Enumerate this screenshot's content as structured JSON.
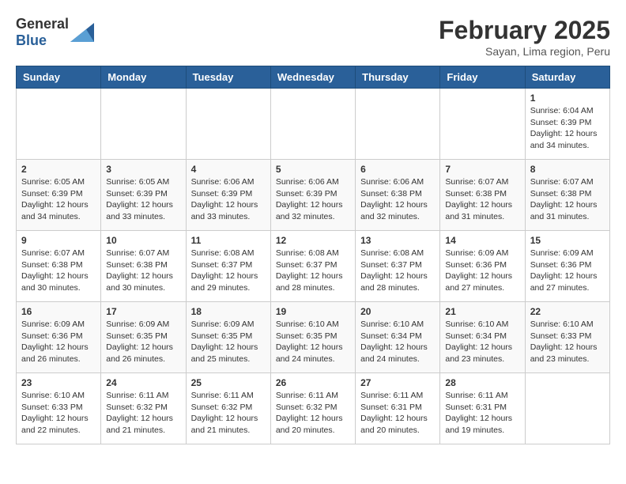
{
  "header": {
    "logo_general": "General",
    "logo_blue": "Blue",
    "month_title": "February 2025",
    "subtitle": "Sayan, Lima region, Peru"
  },
  "weekdays": [
    "Sunday",
    "Monday",
    "Tuesday",
    "Wednesday",
    "Thursday",
    "Friday",
    "Saturday"
  ],
  "weeks": [
    [
      {
        "day": "",
        "info": ""
      },
      {
        "day": "",
        "info": ""
      },
      {
        "day": "",
        "info": ""
      },
      {
        "day": "",
        "info": ""
      },
      {
        "day": "",
        "info": ""
      },
      {
        "day": "",
        "info": ""
      },
      {
        "day": "1",
        "info": "Sunrise: 6:04 AM\nSunset: 6:39 PM\nDaylight: 12 hours\nand 34 minutes."
      }
    ],
    [
      {
        "day": "2",
        "info": "Sunrise: 6:05 AM\nSunset: 6:39 PM\nDaylight: 12 hours\nand 34 minutes."
      },
      {
        "day": "3",
        "info": "Sunrise: 6:05 AM\nSunset: 6:39 PM\nDaylight: 12 hours\nand 33 minutes."
      },
      {
        "day": "4",
        "info": "Sunrise: 6:06 AM\nSunset: 6:39 PM\nDaylight: 12 hours\nand 33 minutes."
      },
      {
        "day": "5",
        "info": "Sunrise: 6:06 AM\nSunset: 6:39 PM\nDaylight: 12 hours\nand 32 minutes."
      },
      {
        "day": "6",
        "info": "Sunrise: 6:06 AM\nSunset: 6:38 PM\nDaylight: 12 hours\nand 32 minutes."
      },
      {
        "day": "7",
        "info": "Sunrise: 6:07 AM\nSunset: 6:38 PM\nDaylight: 12 hours\nand 31 minutes."
      },
      {
        "day": "8",
        "info": "Sunrise: 6:07 AM\nSunset: 6:38 PM\nDaylight: 12 hours\nand 31 minutes."
      }
    ],
    [
      {
        "day": "9",
        "info": "Sunrise: 6:07 AM\nSunset: 6:38 PM\nDaylight: 12 hours\nand 30 minutes."
      },
      {
        "day": "10",
        "info": "Sunrise: 6:07 AM\nSunset: 6:38 PM\nDaylight: 12 hours\nand 30 minutes."
      },
      {
        "day": "11",
        "info": "Sunrise: 6:08 AM\nSunset: 6:37 PM\nDaylight: 12 hours\nand 29 minutes."
      },
      {
        "day": "12",
        "info": "Sunrise: 6:08 AM\nSunset: 6:37 PM\nDaylight: 12 hours\nand 28 minutes."
      },
      {
        "day": "13",
        "info": "Sunrise: 6:08 AM\nSunset: 6:37 PM\nDaylight: 12 hours\nand 28 minutes."
      },
      {
        "day": "14",
        "info": "Sunrise: 6:09 AM\nSunset: 6:36 PM\nDaylight: 12 hours\nand 27 minutes."
      },
      {
        "day": "15",
        "info": "Sunrise: 6:09 AM\nSunset: 6:36 PM\nDaylight: 12 hours\nand 27 minutes."
      }
    ],
    [
      {
        "day": "16",
        "info": "Sunrise: 6:09 AM\nSunset: 6:36 PM\nDaylight: 12 hours\nand 26 minutes."
      },
      {
        "day": "17",
        "info": "Sunrise: 6:09 AM\nSunset: 6:35 PM\nDaylight: 12 hours\nand 26 minutes."
      },
      {
        "day": "18",
        "info": "Sunrise: 6:09 AM\nSunset: 6:35 PM\nDaylight: 12 hours\nand 25 minutes."
      },
      {
        "day": "19",
        "info": "Sunrise: 6:10 AM\nSunset: 6:35 PM\nDaylight: 12 hours\nand 24 minutes."
      },
      {
        "day": "20",
        "info": "Sunrise: 6:10 AM\nSunset: 6:34 PM\nDaylight: 12 hours\nand 24 minutes."
      },
      {
        "day": "21",
        "info": "Sunrise: 6:10 AM\nSunset: 6:34 PM\nDaylight: 12 hours\nand 23 minutes."
      },
      {
        "day": "22",
        "info": "Sunrise: 6:10 AM\nSunset: 6:33 PM\nDaylight: 12 hours\nand 23 minutes."
      }
    ],
    [
      {
        "day": "23",
        "info": "Sunrise: 6:10 AM\nSunset: 6:33 PM\nDaylight: 12 hours\nand 22 minutes."
      },
      {
        "day": "24",
        "info": "Sunrise: 6:11 AM\nSunset: 6:32 PM\nDaylight: 12 hours\nand 21 minutes."
      },
      {
        "day": "25",
        "info": "Sunrise: 6:11 AM\nSunset: 6:32 PM\nDaylight: 12 hours\nand 21 minutes."
      },
      {
        "day": "26",
        "info": "Sunrise: 6:11 AM\nSunset: 6:32 PM\nDaylight: 12 hours\nand 20 minutes."
      },
      {
        "day": "27",
        "info": "Sunrise: 6:11 AM\nSunset: 6:31 PM\nDaylight: 12 hours\nand 20 minutes."
      },
      {
        "day": "28",
        "info": "Sunrise: 6:11 AM\nSunset: 6:31 PM\nDaylight: 12 hours\nand 19 minutes."
      },
      {
        "day": "",
        "info": ""
      }
    ]
  ]
}
